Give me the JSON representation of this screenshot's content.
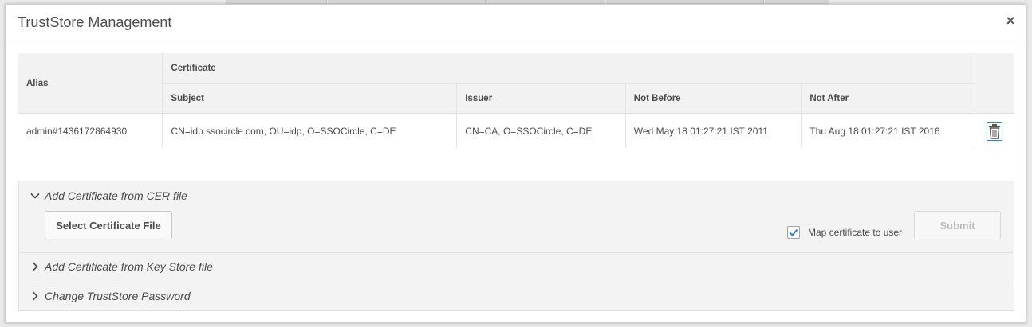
{
  "dialog": {
    "title": "TrustStore Management",
    "close_label": "×"
  },
  "table": {
    "headers": {
      "alias": "Alias",
      "certificate": "Certificate",
      "subject": "Subject",
      "issuer": "Issuer",
      "not_before": "Not Before",
      "not_after": "Not After"
    },
    "rows": [
      {
        "alias": "admin#1436172864930",
        "subject": "CN=idp.ssocircle.com, OU=idp, O=SSOCircle, C=DE",
        "issuer": "CN=CA, O=SSOCircle, C=DE",
        "not_before": "Wed May 18 01:27:21 IST 2011",
        "not_after": "Thu Aug 18 01:27:21 IST 2016"
      }
    ]
  },
  "accordion": {
    "items": [
      {
        "label": "Add Certificate from CER file",
        "expanded": true
      },
      {
        "label": "Add Certificate from Key Store file",
        "expanded": false
      },
      {
        "label": "Change TrustStore Password",
        "expanded": false
      }
    ],
    "select_file_label": "Select Certificate File",
    "map_certificate_label": "Map certificate to user",
    "map_certificate_checked": true,
    "submit_label": "Submit"
  },
  "colors": {
    "accent": "#2680eb",
    "header_bg": "#f2f2f2",
    "panel_bg": "#f3f3f3"
  }
}
